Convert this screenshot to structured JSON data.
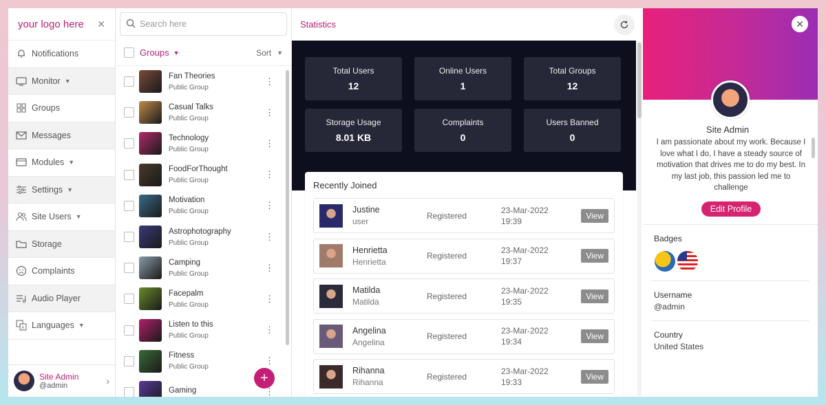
{
  "logo": "your logo here",
  "nav": [
    {
      "label": "Notifications",
      "icon": "bell-icon",
      "chevron": false
    },
    {
      "label": "Monitor",
      "icon": "monitor-icon",
      "chevron": true
    },
    {
      "label": "Groups",
      "icon": "groups-icon",
      "chevron": false
    },
    {
      "label": "Messages",
      "icon": "envelope-icon",
      "chevron": false
    },
    {
      "label": "Modules",
      "icon": "modules-icon",
      "chevron": true
    },
    {
      "label": "Settings",
      "icon": "sliders-icon",
      "chevron": true
    },
    {
      "label": "Site Users",
      "icon": "users-icon",
      "chevron": true
    },
    {
      "label": "Storage",
      "icon": "folder-icon",
      "chevron": false
    },
    {
      "label": "Complaints",
      "icon": "sad-face-icon",
      "chevron": false
    },
    {
      "label": "Audio Player",
      "icon": "playlist-icon",
      "chevron": false
    },
    {
      "label": "Languages",
      "icon": "translate-icon",
      "chevron": true
    }
  ],
  "footer_user": {
    "name": "Site Admin",
    "handle": "@admin"
  },
  "search": {
    "placeholder": "Search here"
  },
  "groups_header": {
    "label": "Groups",
    "sort": "Sort"
  },
  "groups": [
    {
      "name": "Fan Theories",
      "type": "Public Group"
    },
    {
      "name": "Casual Talks",
      "type": "Public Group"
    },
    {
      "name": "Technology",
      "type": "Public Group"
    },
    {
      "name": "FoodForThought",
      "type": "Public Group"
    },
    {
      "name": "Motivation",
      "type": "Public Group"
    },
    {
      "name": "Astrophotography",
      "type": "Public Group"
    },
    {
      "name": "Camping",
      "type": "Public Group"
    },
    {
      "name": "Facepalm",
      "type": "Public Group"
    },
    {
      "name": "Listen to this",
      "type": "Public Group"
    },
    {
      "name": "Fitness",
      "type": "Public Group"
    },
    {
      "name": "Gaming",
      "type": ""
    }
  ],
  "thumb_colors": [
    "#7a4a3a",
    "#c08a4a",
    "#b02a6a",
    "#4a3a2a",
    "#3a6a8a",
    "#3a3a7a",
    "#8a9aa6",
    "#6a8a2a",
    "#b0206a",
    "#3a6a3a",
    "#5a3a9a"
  ],
  "main": {
    "title": "Statistics"
  },
  "stats": [
    {
      "title": "Total Users",
      "value": "12"
    },
    {
      "title": "Online Users",
      "value": "1"
    },
    {
      "title": "Total Groups",
      "value": "12"
    },
    {
      "title": "Storage Usage",
      "value": "8.01 KB"
    },
    {
      "title": "Complaints",
      "value": "0"
    },
    {
      "title": "Users Banned",
      "value": "0"
    }
  ],
  "recent": {
    "title": "Recently Joined",
    "users": [
      {
        "name": "Justine",
        "sub": "user",
        "status": "Registered",
        "date": "23-Mar-2022",
        "time": "19:39",
        "action": "View"
      },
      {
        "name": "Henrietta",
        "sub": "Henrietta",
        "status": "Registered",
        "date": "23-Mar-2022",
        "time": "19:37",
        "action": "View"
      },
      {
        "name": "Matilda",
        "sub": "Matilda",
        "status": "Registered",
        "date": "23-Mar-2022",
        "time": "19:35",
        "action": "View"
      },
      {
        "name": "Angelina",
        "sub": "Angelina",
        "status": "Registered",
        "date": "23-Mar-2022",
        "time": "19:34",
        "action": "View"
      },
      {
        "name": "Rihanna",
        "sub": "Rihanna",
        "status": "Registered",
        "date": "23-Mar-2022",
        "time": "19:33",
        "action": "View"
      }
    ]
  },
  "user_thumb_colors": [
    "#2a2a6a",
    "#a07a6a",
    "#2a2a3a",
    "#6a5a7a",
    "#3a2a2a"
  ],
  "profile": {
    "name": "Site Admin",
    "bio": "I am passionate about my work. Because I love what I do, I have a steady source of motivation that drives me to do my best. In my last job, this passion led me to challenge",
    "edit": "Edit Profile",
    "badges_label": "Badges",
    "username_label": "Username",
    "username": "@admin",
    "country_label": "Country",
    "country": "United States"
  }
}
